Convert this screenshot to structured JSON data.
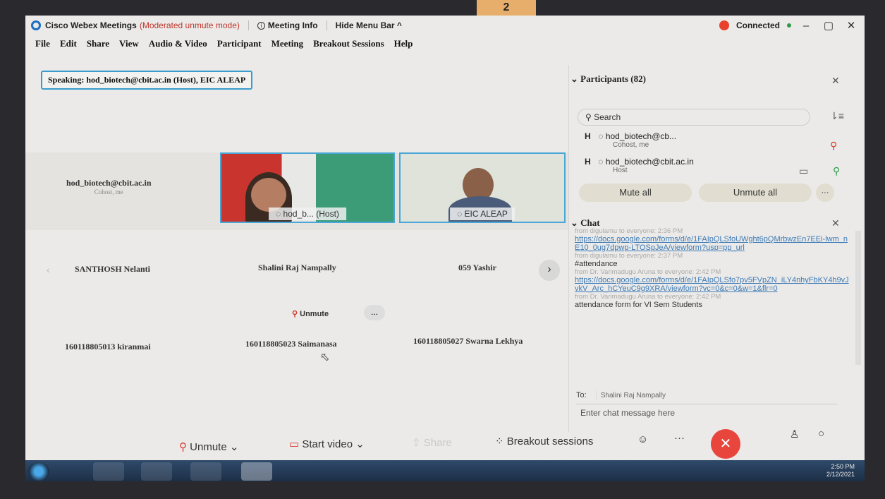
{
  "tag_label": "2",
  "window": {
    "title": "Cisco Webex Meetings",
    "mode": "(Moderated unmute mode)",
    "meeting_info": "Meeting Info",
    "hide_menu": "Hide Menu Bar ^",
    "status": "Connected"
  },
  "menu": [
    "File",
    "Edit",
    "Share",
    "View",
    "Audio & Video",
    "Participant",
    "Meeting",
    "Breakout Sessions",
    "Help"
  ],
  "speaking": "Speaking: hod_biotech@cbit.ac.in (Host), EIC ALEAP",
  "tiles": {
    "host_name": "hod_biotech@cbit.ac.in",
    "host_sub": "Cohost, me",
    "video1_label": "hod_b... (Host)",
    "video2_label": "EIC ALEAP",
    "row2": [
      "SANTHOSH Nelanti",
      "Shalini Raj Nampally",
      "059 Yashir"
    ],
    "row3": [
      "160118805013 kiranmai",
      "160118805023 Saimanasa",
      "160118805027 Swarna Lekhya"
    ],
    "unmute_chip": "Unmute",
    "more": "..."
  },
  "participants": {
    "header": "Participants (82)",
    "search_placeholder": "Search",
    "rows": [
      {
        "avatar": "H",
        "name": "hod_biotech@cb...",
        "role": "Cohost, me"
      },
      {
        "avatar": "H",
        "name": "hod_biotech@cbit.ac.in",
        "role": "Host"
      }
    ],
    "mute_all": "Mute all",
    "unmute_all": "Unmute all"
  },
  "chat": {
    "header": "Chat",
    "messages": [
      {
        "meta": "from digulamu to everyone:   2:36 PM",
        "link": "https://docs.google.com/forms/d/e/1FAIpQLSfoUWght6pQMrbwzEn7EEi-lwm_nE10_0ug7dpwp-LTOSpJeA/viewform?usp=pp_url",
        "text": ""
      },
      {
        "meta": "from digulamu to everyone:   2:37 PM",
        "link": "",
        "text": "#attendance"
      },
      {
        "meta": "from Dr. Varimadugu Aruna to everyone:   2:42 PM",
        "link": "https://docs.google.com/forms/d/e/1FAIpQLSfo7pv5FVpZN_iLY4nhyFbKY4h9vJvkV_Arc_hCYeuC9g9XRA/viewform?vc=0&c=0&w=1&flr=0",
        "text": ""
      },
      {
        "meta": "from Dr. Varimadugu Aruna to everyone:   2:42 PM",
        "link": "",
        "text": "attendance form for VI Sem Students"
      }
    ],
    "to_label": "To:",
    "to_value": "Shalini Raj Nampally",
    "input_placeholder": "Enter chat message here"
  },
  "controls": {
    "unmute": "Unmute",
    "start_video": "Start video",
    "share": "Share",
    "breakout": "Breakout sessions"
  },
  "clock": {
    "time": "2:50 PM",
    "date": "2/12/2021"
  }
}
